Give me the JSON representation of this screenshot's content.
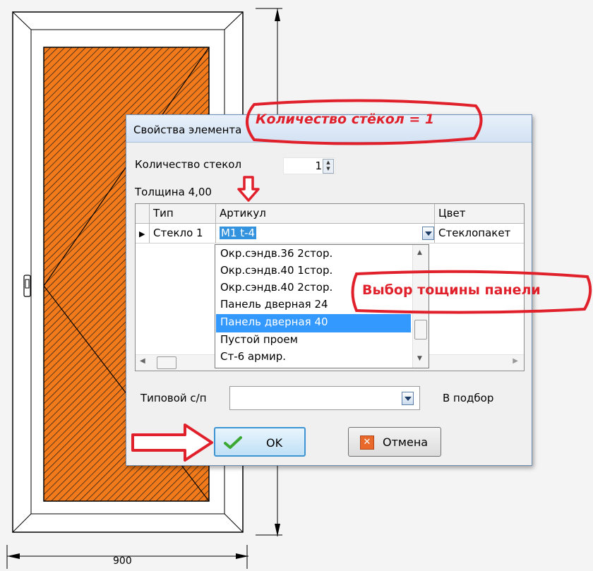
{
  "drawing": {
    "width_dimension": "900"
  },
  "dialog": {
    "title": "Свойства элемента",
    "glass_count_label": "Количество стекол",
    "glass_count_value": "1",
    "thickness_label": "Толщина 4,00",
    "grid": {
      "columns": [
        "Тип",
        "Артикул",
        "Цвет"
      ],
      "row": {
        "type": "Стекло 1",
        "article": "M1 t-4",
        "color": "Стеклопакет"
      }
    },
    "dropdown": {
      "items": [
        "Окр.сэндв.36 2стор.",
        "Окр.сэндв.40 1стор.",
        "Окр.сэндв.40 2стор.",
        "Панель дверная 24",
        "Панель дверная 40",
        "Пустой проем",
        "Ст-6 армир."
      ],
      "selected_index": 4
    },
    "typical_label": "Типовой с/п",
    "typical_value": "",
    "selection_label": "В подбор",
    "ok_label": "OK",
    "cancel_label": "Отмена"
  },
  "annotations": {
    "glass_count_note": "Количество стёкол = 1",
    "panel_thickness_note": "Выбор тощины панели"
  },
  "colors": {
    "annotation_red": "#e0202a",
    "panel_fill": "#f27a1a",
    "selection_blue": "#3399ff"
  }
}
